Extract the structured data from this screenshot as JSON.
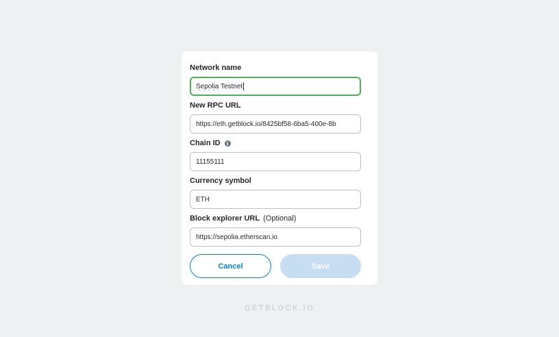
{
  "form": {
    "network_name": {
      "label": "Network name",
      "value_word1": "Sepolia",
      "value_rest": " Testnet"
    },
    "rpc_url": {
      "label": "New RPC URL",
      "value": "https://eth.getblock.io/8425bf58-6ba5-400e-8b"
    },
    "chain_id": {
      "label": "Chain ID",
      "info_icon": "info-icon",
      "value": "11155111"
    },
    "currency_symbol": {
      "label": "Currency symbol",
      "value": "ETH"
    },
    "block_explorer": {
      "label": "Block explorer URL",
      "optional": "(Optional)",
      "value": "https://sepolia.etherscan.io"
    },
    "buttons": {
      "cancel": "Cancel",
      "save": "Save"
    }
  },
  "footer": {
    "brand": "GETBLOCK.IO"
  },
  "colors": {
    "accent": "#037dd6",
    "focus_border": "#4fae57",
    "save_disabled": "#c6ddf2",
    "background": "#eff0f1"
  }
}
